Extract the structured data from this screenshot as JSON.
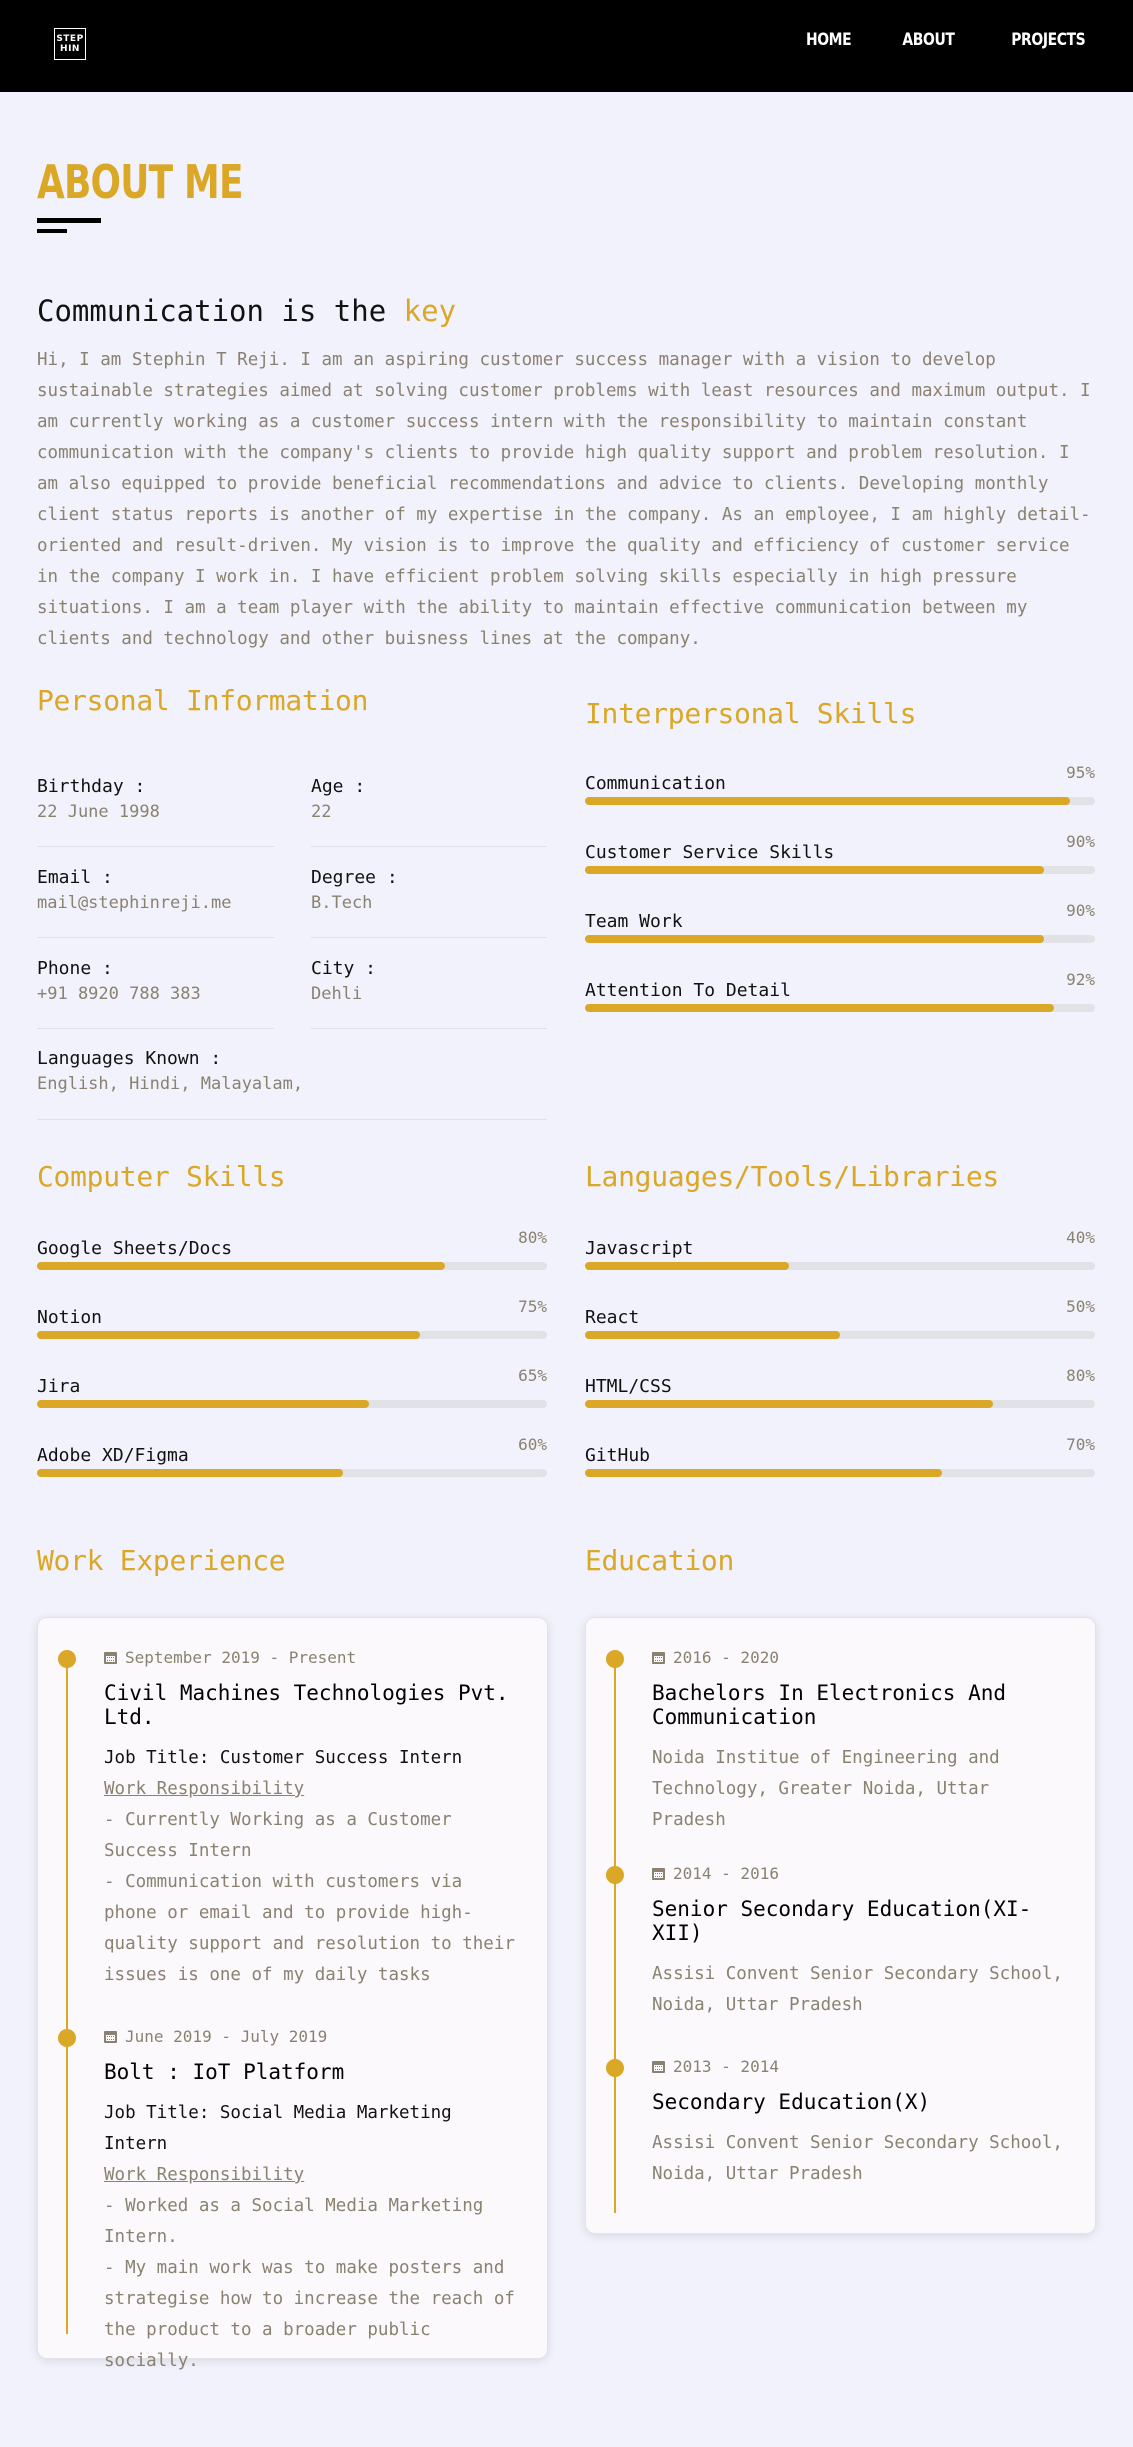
{
  "nav": {
    "logo_text": "STEP HIN",
    "links": [
      "HOME",
      "ABOUT",
      "PROJECTS"
    ]
  },
  "hero": {
    "title": "ABOUT ME",
    "tagline_prefix": "Communication is the",
    "tagline_highlight": "key",
    "intro": "Hi, I am Stephin T Reji. I am an aspiring customer success manager with a vision to develop sustainable strategies aimed at solving customer problems with least resources and maximum output. I am currently working as a customer success intern with the responsibility to maintain constant communication with the company's clients to provide high quality support and problem resolution. I am also equipped to provide beneficial recommendations and advice to clients. Developing monthly client status reports is another of my expertise in the company. As an employee, I am highly detail-oriented and result-driven. My vision is to improve the quality and efficiency of customer service in the company I work in. I have efficient problem solving skills especially in high pressure situations. I am a team player with the ability to maintain effective communication between my clients and technology and other buisness lines at the company."
  },
  "personal": {
    "heading": "Personal Information",
    "items": [
      {
        "label": "Birthday :",
        "value": "22 June 1998"
      },
      {
        "label": "Age :",
        "value": "22"
      },
      {
        "label": "Email :",
        "value": "mail@stephinreji.me"
      },
      {
        "label": "Degree :",
        "value": "B.Tech"
      },
      {
        "label": "Phone :",
        "value": "+91 8920 788 383"
      },
      {
        "label": "City :",
        "value": "Dehli"
      },
      {
        "label": "Languages Known :",
        "value": "English, Hindi, Malayalam,"
      }
    ]
  },
  "interpersonal": {
    "heading": "Interpersonal Skills",
    "skills": [
      {
        "name": "Communication",
        "percent_label": "95%",
        "level": 0.95
      },
      {
        "name": "Customer Service Skills",
        "percent_label": "90%",
        "level": 0.9
      },
      {
        "name": "Team Work",
        "percent_label": "90%",
        "level": 0.9
      },
      {
        "name": "Attention To Detail",
        "percent_label": "92%",
        "level": 0.92
      }
    ]
  },
  "computer": {
    "heading": "Computer Skills",
    "skills": [
      {
        "name": "Google Sheets/Docs",
        "percent_label": "80%",
        "level": 0.8
      },
      {
        "name": "Notion",
        "percent_label": "75%",
        "level": 0.75
      },
      {
        "name": "Jira",
        "percent_label": "65%",
        "level": 0.65
      },
      {
        "name": "Adobe XD/Figma",
        "percent_label": "60%",
        "level": 0.6
      }
    ]
  },
  "languages": {
    "heading": "Languages/Tools/Libraries",
    "skills": [
      {
        "name": "Javascript",
        "percent_label": "40%",
        "level": 0.4
      },
      {
        "name": "React",
        "percent_label": "50%",
        "level": 0.5
      },
      {
        "name": "HTML/CSS",
        "percent_label": "80%",
        "level": 0.8
      },
      {
        "name": "GitHub",
        "percent_label": "70%",
        "level": 0.7
      }
    ]
  },
  "work": {
    "heading": "Work Experience",
    "entries": [
      {
        "date": "September 2019 - Present",
        "company": "Civil Machines Technologies Pvt. Ltd.",
        "job_title": "Job Title: Customer Success Intern",
        "responsibility_label": "Work Responsibility",
        "points": [
          "- Currently Working as a Customer Success Intern",
          "- Communication with customers via phone or email and to provide high-quality support and resolution to their issues is one of my daily tasks"
        ]
      },
      {
        "date": "June 2019 - July 2019",
        "company": "Bolt : IoT Platform",
        "job_title": "Job Title: Social Media Marketing Intern",
        "responsibility_label": "Work Responsibility",
        "points": [
          "- Worked as a Social Media Marketing Intern.",
          "- My main work was to make posters and strategise how to increase the reach of the product to a broader public socially."
        ]
      }
    ]
  },
  "education": {
    "heading": "Education",
    "entries": [
      {
        "date": "2016 - 2020",
        "title": "Bachelors In Electronics And Communication",
        "place": "Noida Institue of Engineering and Technology, Greater Noida, Uttar Pradesh"
      },
      {
        "date": "2014 - 2016",
        "title": "Senior Secondary Education(XI-XII)",
        "place": "Assisi Convent Senior Secondary School, Noida, Uttar Pradesh"
      },
      {
        "date": "2013 - 2014",
        "title": "Secondary Education(X)",
        "place": "Assisi Convent Senior Secondary School, Noida, Uttar Pradesh"
      }
    ]
  },
  "colors": {
    "accent": "#dba726",
    "muted_text": "#8a8170",
    "background": "#f1f2fb",
    "nav": "#000000"
  },
  "icons": {
    "date_icon": "calendar-icon"
  }
}
